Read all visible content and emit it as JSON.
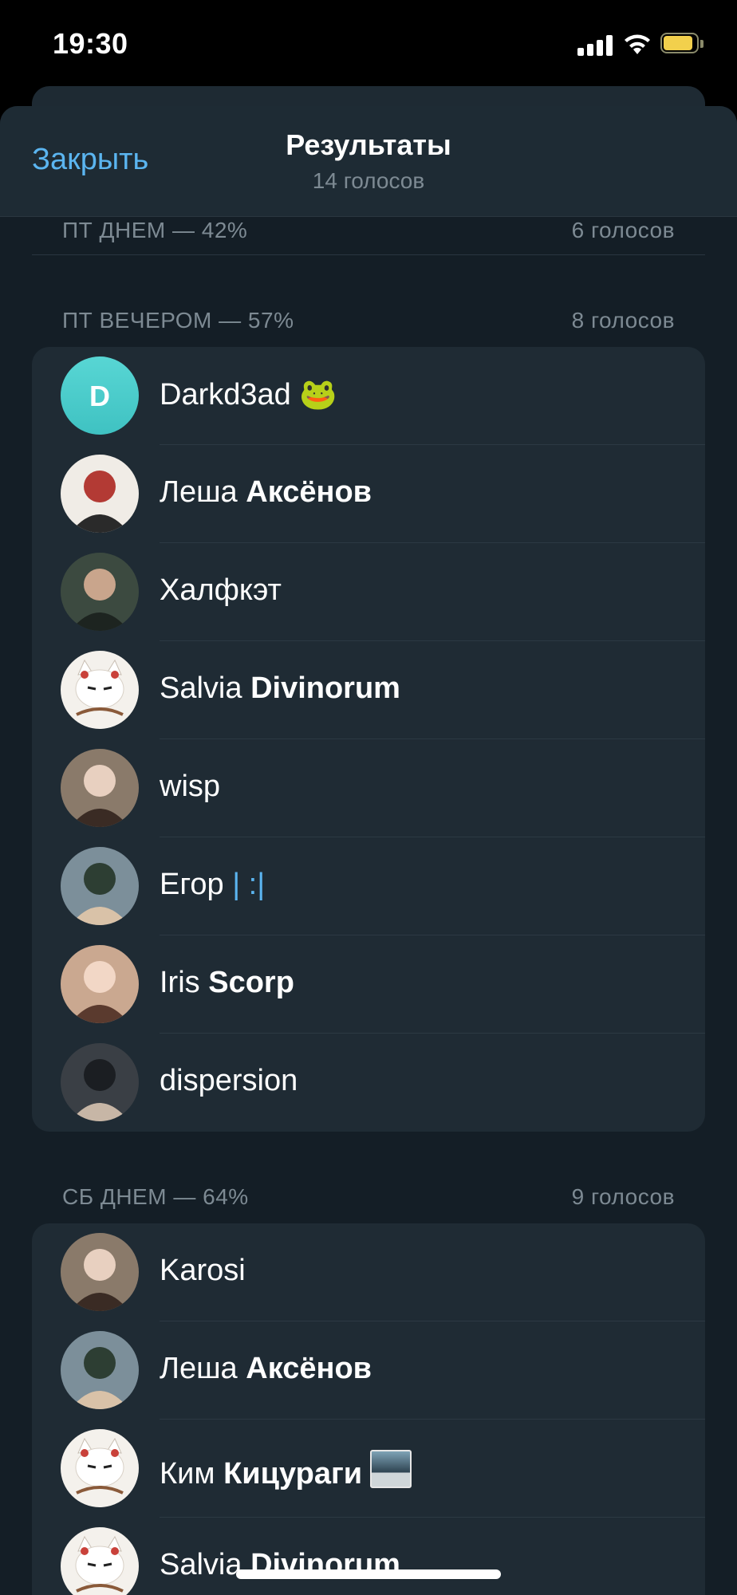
{
  "status": {
    "time": "19:30"
  },
  "header": {
    "close": "Закрыть",
    "title": "Результаты",
    "subtitle": "14 голосов"
  },
  "sections": [
    {
      "label": "ПТ ДНЕМ — 42%",
      "votes": "6 голосов"
    },
    {
      "label": "ПТ ВЕЧЕРОМ — 57%",
      "votes": "8 голосов"
    },
    {
      "label": "СБ ДНЕМ — 64%",
      "votes": "9 голосов"
    }
  ],
  "group_fri_evening": [
    {
      "first": "Darkd3ad",
      "last": "",
      "suffix": "🐸",
      "avatar": "letter-avatar",
      "initial": "D"
    },
    {
      "first": "Леша",
      "last": "Аксёнов",
      "suffix": "",
      "avatar": "photo-avatar"
    },
    {
      "first": "Халфкэт",
      "last": "",
      "suffix": "",
      "avatar": "photo-avatar"
    },
    {
      "first": "Salvia",
      "last": "Divinorum",
      "suffix": "",
      "avatar": "cat-avatar"
    },
    {
      "first": "wisp",
      "last": "",
      "suffix": "",
      "avatar": "photo-avatar"
    },
    {
      "first": "Егор",
      "last": "",
      "suffix": "| :|",
      "avatar": "photo-avatar"
    },
    {
      "first": "Iris",
      "last": "Scorp",
      "suffix": "",
      "avatar": "photo-avatar"
    },
    {
      "first": "dispersion",
      "last": "",
      "suffix": "",
      "avatar": "photo-avatar"
    }
  ],
  "group_sat_day": [
    {
      "first": "Karosi",
      "last": "",
      "suffix": "",
      "avatar": "photo-avatar"
    },
    {
      "first": "Леша",
      "last": "Аксёнов",
      "suffix": "",
      "avatar": "photo-avatar"
    },
    {
      "first": "Ким",
      "last": "Кицураги",
      "suffix": "",
      "avatar": "cat-avatar"
    },
    {
      "first": "Salvia",
      "last": "Divinorum",
      "suffix": "",
      "avatar": "cat-avatar"
    }
  ],
  "colors": {
    "accent": "#5bb5f0",
    "sheet_bg": "#141e26",
    "card_bg": "#1f2b34",
    "secondary_text": "#7d8a93",
    "letter_avatar": "#58d6d4"
  }
}
